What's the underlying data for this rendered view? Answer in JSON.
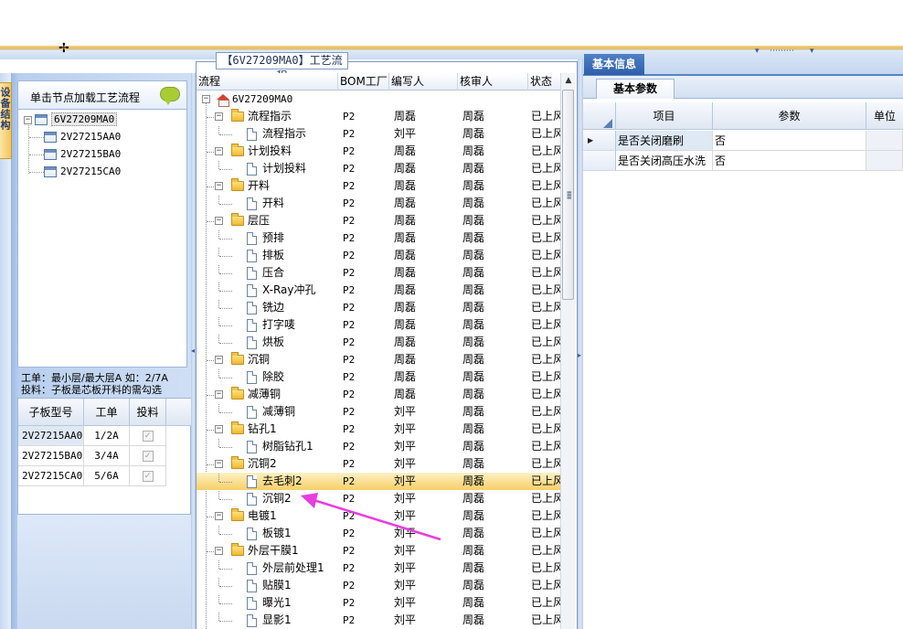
{
  "left_panel": {
    "vertical_tab_label": "设备结构",
    "header_text": "单击节点加载工艺流程",
    "tree": {
      "root": "6V27209MA0",
      "children": [
        "2V27215AA0",
        "2V27215BA0",
        "2V27215CA0"
      ]
    },
    "info_line1": "工单：最小层/最大层A 如：2/7A",
    "info_line2": "投料：子板是芯板开料的需勾选",
    "sub_grid": {
      "headers": [
        "子板型号",
        "工单",
        "投料"
      ],
      "rows": [
        {
          "model": "2V27215AA0",
          "order": "1/2A",
          "feed": true
        },
        {
          "model": "2V27215BA0",
          "order": "3/4A",
          "feed": true
        },
        {
          "model": "2V27215CA0",
          "order": "5/6A",
          "feed": true
        }
      ]
    }
  },
  "middle_panel": {
    "title": "【6V27209MA0】工艺流程",
    "headers": [
      "流程",
      "BOM工厂",
      "编写人",
      "核审人",
      "状态"
    ],
    "root": {
      "label": "6V27209MA0"
    },
    "rows": [
      {
        "label": "流程指示",
        "type": "folder",
        "bom": "P2",
        "writer": "周磊",
        "reviewer": "周磊",
        "status": "已上风"
      },
      {
        "label": "流程指示",
        "type": "doc",
        "bom": "P2",
        "writer": "刘平",
        "reviewer": "周磊",
        "status": "已上风"
      },
      {
        "label": "计划投料",
        "type": "folder",
        "bom": "P2",
        "writer": "周磊",
        "reviewer": "周磊",
        "status": "已上风"
      },
      {
        "label": "计划投料",
        "type": "doc",
        "bom": "P2",
        "writer": "周磊",
        "reviewer": "周磊",
        "status": "已上风"
      },
      {
        "label": "开料",
        "type": "folder",
        "bom": "P2",
        "writer": "周磊",
        "reviewer": "周磊",
        "status": "已上风"
      },
      {
        "label": "开料",
        "type": "doc",
        "bom": "P2",
        "writer": "周磊",
        "reviewer": "周磊",
        "status": "已上风"
      },
      {
        "label": "层压",
        "type": "folder",
        "bom": "P2",
        "writer": "周磊",
        "reviewer": "周磊",
        "status": "已上风"
      },
      {
        "label": "预排",
        "type": "doc",
        "bom": "P2",
        "writer": "周磊",
        "reviewer": "周磊",
        "status": "已上风"
      },
      {
        "label": "排板",
        "type": "doc",
        "bom": "P2",
        "writer": "周磊",
        "reviewer": "周磊",
        "status": "已上风"
      },
      {
        "label": "压合",
        "type": "doc",
        "bom": "P2",
        "writer": "周磊",
        "reviewer": "周磊",
        "status": "已上风"
      },
      {
        "label": "X-Ray冲孔",
        "type": "doc",
        "bom": "P2",
        "writer": "周磊",
        "reviewer": "周磊",
        "status": "已上风"
      },
      {
        "label": "铣边",
        "type": "doc",
        "bom": "P2",
        "writer": "周磊",
        "reviewer": "周磊",
        "status": "已上风"
      },
      {
        "label": "打字唛",
        "type": "doc",
        "bom": "P2",
        "writer": "周磊",
        "reviewer": "周磊",
        "status": "已上风"
      },
      {
        "label": "烘板",
        "type": "doc",
        "bom": "P2",
        "writer": "周磊",
        "reviewer": "周磊",
        "status": "已上风"
      },
      {
        "label": "沉铜",
        "type": "folder",
        "bom": "P2",
        "writer": "周磊",
        "reviewer": "周磊",
        "status": "已上风"
      },
      {
        "label": "除胶",
        "type": "doc",
        "bom": "P2",
        "writer": "周磊",
        "reviewer": "周磊",
        "status": "已上风"
      },
      {
        "label": "减薄铜",
        "type": "folder",
        "bom": "P2",
        "writer": "周磊",
        "reviewer": "周磊",
        "status": "已上风"
      },
      {
        "label": "减薄铜",
        "type": "doc",
        "bom": "P2",
        "writer": "刘平",
        "reviewer": "周磊",
        "status": "已上风"
      },
      {
        "label": "钻孔1",
        "type": "folder",
        "bom": "P2",
        "writer": "刘平",
        "reviewer": "周磊",
        "status": "已上风"
      },
      {
        "label": "树脂钻孔1",
        "type": "doc",
        "bom": "P2",
        "writer": "刘平",
        "reviewer": "周磊",
        "status": "已上风"
      },
      {
        "label": "沉铜2",
        "type": "folder",
        "bom": "P2",
        "writer": "刘平",
        "reviewer": "周磊",
        "status": "已上风"
      },
      {
        "label": "去毛刺2",
        "type": "doc",
        "bom": "P2",
        "writer": "刘平",
        "reviewer": "周磊",
        "status": "已上风",
        "selected": true
      },
      {
        "label": "沉铜2",
        "type": "doc",
        "bom": "P2",
        "writer": "刘平",
        "reviewer": "周磊",
        "status": "已上风"
      },
      {
        "label": "电镀1",
        "type": "folder",
        "bom": "P2",
        "writer": "刘平",
        "reviewer": "周磊",
        "status": "已上风"
      },
      {
        "label": "板镀1",
        "type": "doc",
        "bom": "P2",
        "writer": "刘平",
        "reviewer": "周磊",
        "status": "已上风"
      },
      {
        "label": "外层干膜1",
        "type": "folder",
        "bom": "P2",
        "writer": "刘平",
        "reviewer": "周磊",
        "status": "已上风"
      },
      {
        "label": "外层前处理1",
        "type": "doc",
        "bom": "P2",
        "writer": "刘平",
        "reviewer": "周磊",
        "status": "已上风"
      },
      {
        "label": "贴膜1",
        "type": "doc",
        "bom": "P2",
        "writer": "刘平",
        "reviewer": "周磊",
        "status": "已上风"
      },
      {
        "label": "曝光1",
        "type": "doc",
        "bom": "P2",
        "writer": "刘平",
        "reviewer": "周磊",
        "status": "已上风"
      },
      {
        "label": "显影1",
        "type": "doc",
        "bom": "P2",
        "writer": "刘平",
        "reviewer": "周磊",
        "status": "已上风"
      }
    ]
  },
  "right_panel": {
    "tab_label": "基本信息",
    "sub_tab_label": "基本参数",
    "headers": [
      "项目",
      "参数",
      "单位"
    ],
    "rows": [
      {
        "item": "是否关闭磨刷",
        "value": "否",
        "unit": ""
      },
      {
        "item": "是否关闭高压水洗",
        "value": "否",
        "unit": ""
      }
    ]
  },
  "colors": {
    "accent_blue": "#2f5fa8",
    "selection_gold": "#f6cf68",
    "annotation_arrow": "#e83de0"
  }
}
